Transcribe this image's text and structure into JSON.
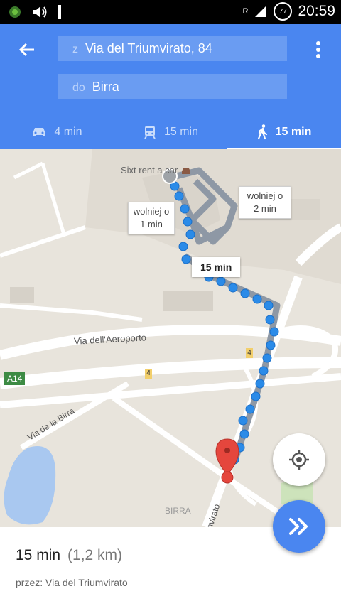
{
  "status": {
    "time": "20:59",
    "battery": "77",
    "network": "R"
  },
  "header": {
    "from_prefix": "z",
    "from_value": "Via del Triumvirato, 84",
    "to_prefix": "do",
    "to_value": "Birra"
  },
  "modes": [
    {
      "label": "4 min",
      "icon": "car-icon"
    },
    {
      "label": "15 min",
      "icon": "train-icon"
    },
    {
      "label": "15 min",
      "icon": "walk-icon"
    }
  ],
  "map": {
    "poi": "Sixt rent a car",
    "alt1_line1": "wolniej o",
    "alt1_line2": "1 min",
    "alt2_line1": "wolniej o",
    "alt2_line2": "2 min",
    "route_time": "15 min",
    "street1": "Via dell'Aeroporto",
    "street2": "Via de la Birra",
    "street3": "nvirato",
    "place": "BIRRA",
    "road_badge": "4",
    "highway": "A14"
  },
  "summary": {
    "duration": "15 min",
    "distance": "(1,2 km)",
    "via": "przez: Via del Triumvirato"
  },
  "colors": {
    "accent": "#4a86f0",
    "route": "#2b8be8",
    "pin": "#e5463d"
  }
}
